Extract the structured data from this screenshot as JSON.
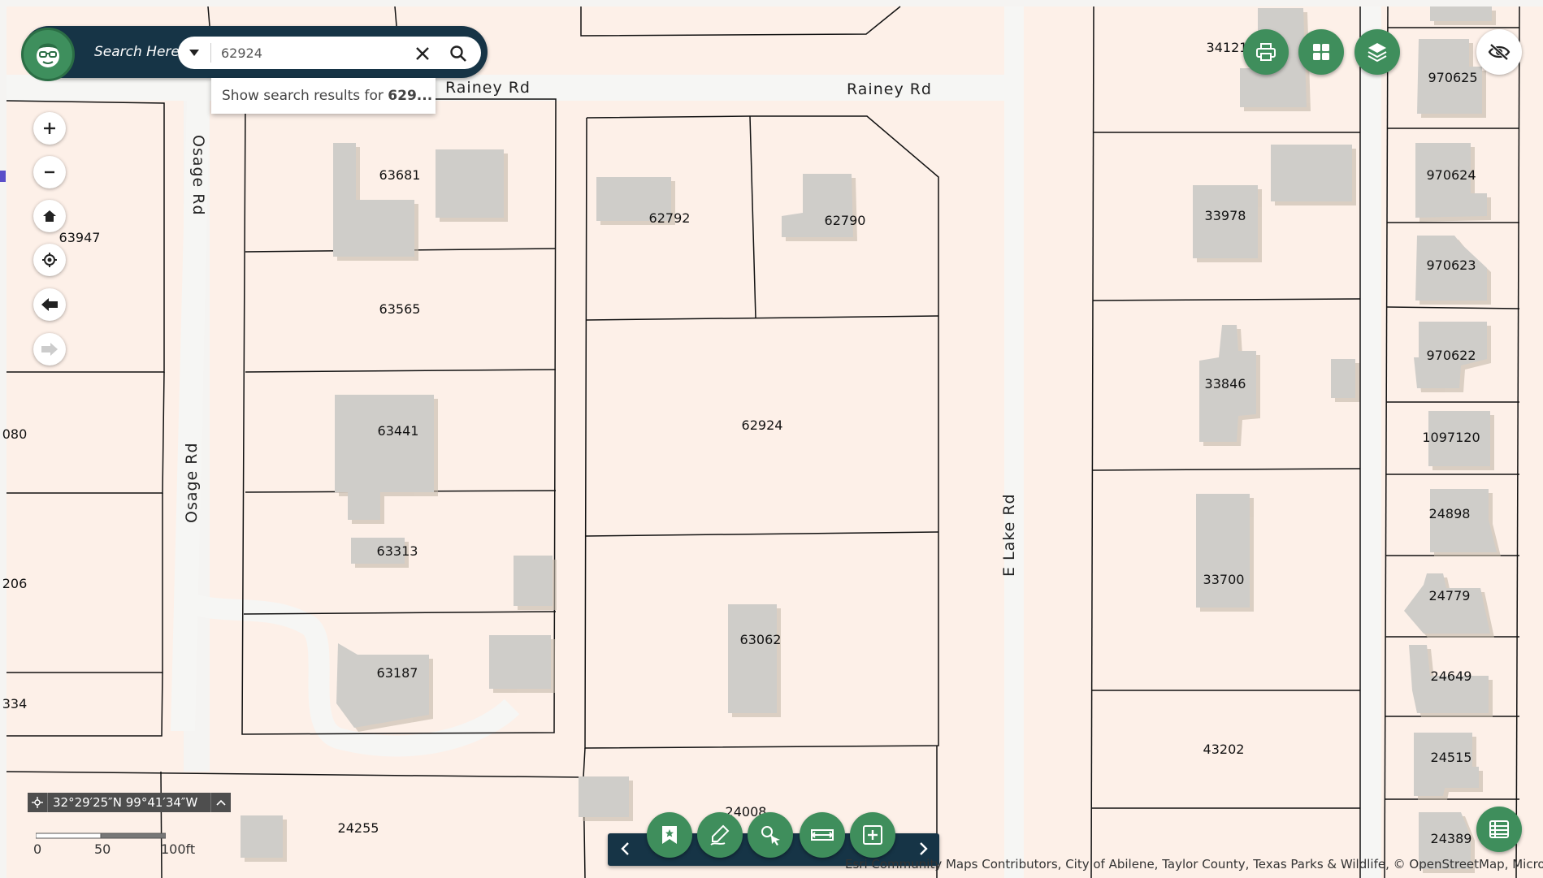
{
  "search": {
    "label": "Search Here:",
    "value": "62924",
    "suggestion_prefix": "Show search results for ",
    "suggestion_term": "629...",
    "dropdown_icon": "caret-down-icon",
    "clear_icon": "close-icon",
    "go_icon": "search-icon"
  },
  "logo_icon": "nerd-face-logo",
  "nav": [
    "zoom-in-icon",
    "zoom-out-icon",
    "home-icon",
    "locate-icon",
    "back-arrow-icon",
    "forward-arrow-icon"
  ],
  "tools": [
    "print-icon",
    "basemap-grid-icon",
    "layers-icon",
    "hide-eye-icon",
    "attribute-table-icon"
  ],
  "roads": {
    "rainey_1": "Rainey Rd",
    "rainey_2": "Rainey Rd",
    "osage_1": "Osage Rd",
    "osage_2": "Osage Rd",
    "elake": "E Lake Rd"
  },
  "parcels": {
    "p63947": "63947",
    "p080": "080",
    "p206": "206",
    "p334": "334",
    "p63681": "63681",
    "p63565": "63565",
    "p63441": "63441",
    "p63313": "63313",
    "p63187": "63187",
    "p62792": "62792",
    "p62790": "62790",
    "p62924": "62924",
    "p63062": "63062",
    "p24008": "24008",
    "p24255": "24255",
    "p34121": "34121",
    "p33978": "33978",
    "p33846": "33846",
    "p33700": "33700",
    "p43202": "43202",
    "p970625": "970625",
    "p970624": "970624",
    "p970623": "970623",
    "p970622": "970622",
    "p1097120": "1097120",
    "p24898": "24898",
    "p24779": "24779",
    "p24649": "24649",
    "p24515": "24515",
    "p24389": "24389"
  },
  "coordinates": "32°29′25″N 99°41′34″W",
  "scale": {
    "l0": "0",
    "l1": "50",
    "l2": "100ft"
  },
  "bottom_tools": [
    "bookmark-icon",
    "draw-pen-icon",
    "identify-pointer-icon",
    "measure-icon",
    "add-data-icon"
  ],
  "attribution": "Esri Community Maps Contributors, City of Abilene, Taylor County, Texas Parks & Wildlife, © OpenStreetMap, Microsoft, ...",
  "colors": {
    "parcel_fill": "#fdf0e8",
    "building": "#cfcdc9",
    "accent_green": "#3f8e5c",
    "navy": "#163446",
    "road": "#f6f6f4"
  }
}
